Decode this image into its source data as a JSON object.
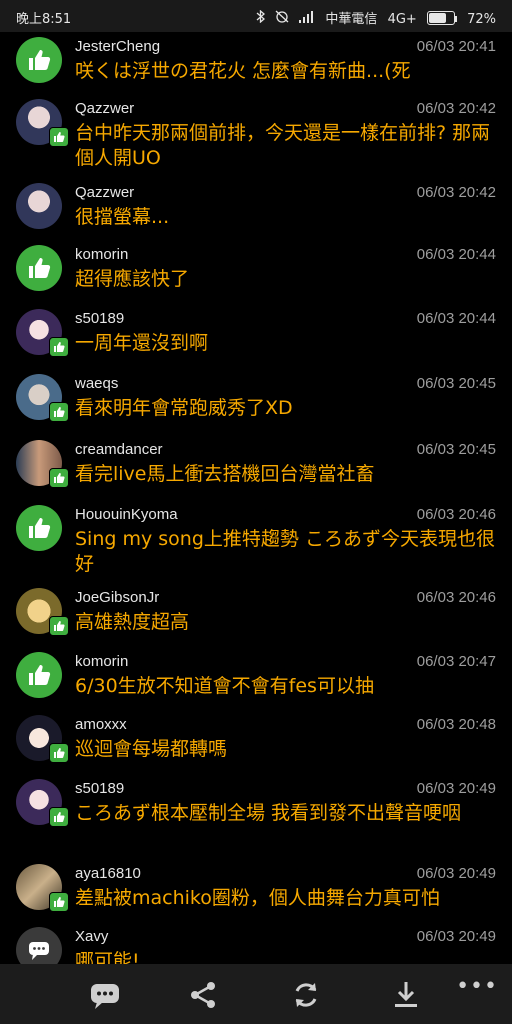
{
  "statusbar": {
    "time": "晚上8:51",
    "carrier": "中華電信",
    "network": "4G+",
    "battery": "72%",
    "battery_level": 0.72,
    "icons": [
      "bluetooth-icon",
      "alarm-off-icon",
      "signal-icon"
    ]
  },
  "comments": [
    {
      "user": "JesterCheng",
      "time": "06/03 20:41",
      "text": "咲くは浮世の君花火 怎麼會有新曲...(死",
      "avatar": "like-icon"
    },
    {
      "user": "Qazzwer",
      "time": "06/03 20:42",
      "text": "台中昨天那兩個前排，今天還是一樣在前排? 那兩個人開UO",
      "avatar": "photo"
    },
    {
      "user": "Qazzwer",
      "time": "06/03 20:42",
      "text": "很擋螢幕...",
      "avatar": "photo"
    },
    {
      "user": "komorin",
      "time": "06/03 20:44",
      "text": "超得應該快了",
      "avatar": "like-icon"
    },
    {
      "user": "s50189",
      "time": "06/03 20:44",
      "text": "一周年還沒到啊",
      "avatar": "photo"
    },
    {
      "user": "waeqs",
      "time": "06/03 20:45",
      "text": "看來明年會常跑威秀了XD",
      "avatar": "photo"
    },
    {
      "user": "creamdancer",
      "time": "06/03 20:45",
      "text": "看完live馬上衝去搭機回台灣當社畜",
      "avatar": "photo"
    },
    {
      "user": "HououinKyoma",
      "time": "06/03 20:46",
      "text": "Sing my song上推特趨勢 ころあず今天表現也很好",
      "avatar": "like-icon"
    },
    {
      "user": "JoeGibsonJr",
      "time": "06/03 20:46",
      "text": "高雄熱度超高",
      "avatar": "photo"
    },
    {
      "user": "komorin",
      "time": "06/03 20:47",
      "text": "6/30生放不知道會不會有fes可以抽",
      "avatar": "like-icon"
    },
    {
      "user": "amoxxx",
      "time": "06/03 20:48",
      "text": "巡迴會每場都轉嗎",
      "avatar": "photo"
    },
    {
      "user": "s50189",
      "time": "06/03 20:49",
      "text": "ころあず根本壓制全場 我看到發不出聲音哽咽",
      "avatar": "photo"
    },
    {
      "user": "aya16810",
      "time": "06/03 20:49",
      "text": "差點被machiko圈粉，個人曲舞台力真可怕",
      "avatar": "photo"
    },
    {
      "user": "Xavy",
      "time": "06/03 20:49",
      "text": "哪可能!",
      "avatar": "chat-icon"
    }
  ],
  "bottombar": {
    "buttons": [
      "chat-icon",
      "share-icon",
      "refresh-icon",
      "download-icon",
      "more-icon"
    ],
    "more_label": "•••"
  },
  "colors": {
    "message": "#f6a800",
    "like_green": "#3fae3f",
    "background": "#000000",
    "username": "#e6e6e6",
    "timestamp": "#9e9e9e"
  }
}
